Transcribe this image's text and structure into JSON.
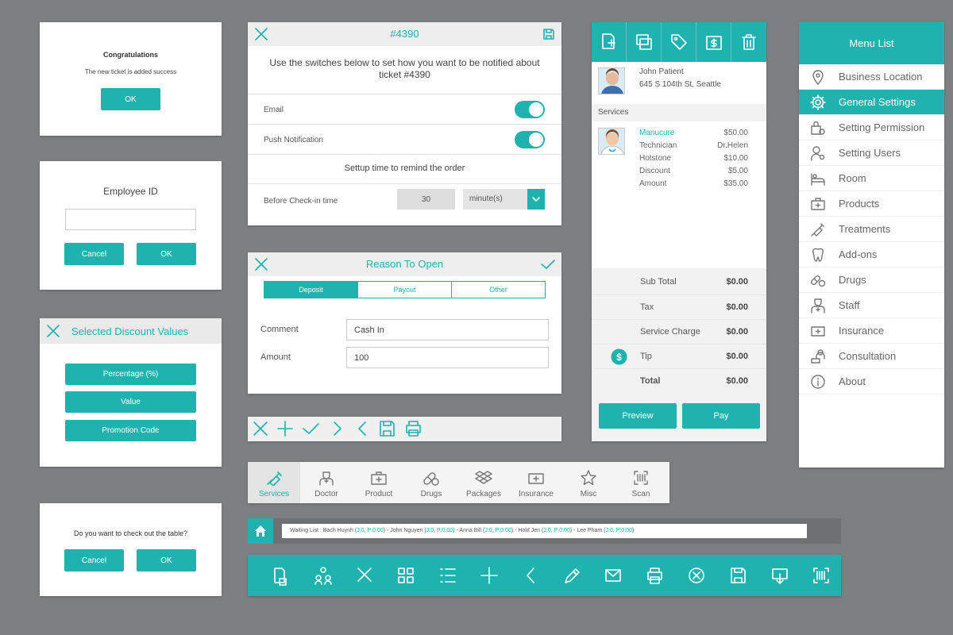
{
  "congrats": {
    "title": "Congratulations",
    "message": "The new ticket is added success",
    "ok": "OK"
  },
  "employee": {
    "title": "Employee ID",
    "value": "",
    "cancel": "Cancel",
    "ok": "OK"
  },
  "discount": {
    "title": "Selected Discount Values",
    "options": [
      "Percentage (%)",
      "Value",
      "Promotion Code"
    ]
  },
  "checkout": {
    "question": "Do you want to check out the table?",
    "cancel": "Cancel",
    "ok": "OK"
  },
  "notify": {
    "ticket": "#4390",
    "description": "Use the switches below to set how you want to be notified about ticket #4390",
    "email_label": "Email",
    "push_label": "Push Notification",
    "email_on": true,
    "push_on": true,
    "setup_title": "Settup time to remind the order",
    "before_label": "Before Check-in time",
    "before_value": "30",
    "unit": "minute(s)"
  },
  "reason": {
    "title": "Reason To Open",
    "tabs": [
      "Deposit",
      "Payout",
      "Other"
    ],
    "active_tab": "Deposit",
    "comment_label": "Comment",
    "comment_value": "Cash In",
    "amount_label": "Amount",
    "amount_value": "100"
  },
  "category_tabs": [
    "Services",
    "Doctor",
    "Product",
    "Drugs",
    "Packages",
    "Insurance",
    "Misc",
    "Scan"
  ],
  "waiting": {
    "prefix": "Waiting List : ",
    "entries": [
      {
        "name": "Bach Huynh",
        "status": "J:0, P:0:00"
      },
      {
        "name": "John Nguyen",
        "status": "J:0, P:0:00"
      },
      {
        "name": "Anna Bill",
        "status": "J:0, P:0:00"
      },
      {
        "name": "Hold Jen",
        "status": "J:0, P:0:00"
      },
      {
        "name": "Lee Pham",
        "status": "J:0, P:0:00"
      }
    ]
  },
  "ticket": {
    "patient_name": "John Patient",
    "patient_address": "645 S 104th St, Seattle",
    "services_header": "Services",
    "service_name": "Manucure",
    "service_price": "$50.00",
    "details": [
      {
        "label": "Technician",
        "value": "Dr.Helen"
      },
      {
        "label": "Hotstone",
        "value": "$10.00"
      },
      {
        "label": "Discount",
        "value": "$5.00"
      },
      {
        "label": "Amount",
        "value": "$35.00"
      }
    ],
    "summary": [
      {
        "label": "Sub Total",
        "value": "$0.00"
      },
      {
        "label": "Tax",
        "value": "$0.00"
      },
      {
        "label": "Service Charge",
        "value": "$0.00"
      },
      {
        "label": "Tip",
        "value": "$0.00"
      },
      {
        "label": "Total",
        "value": "$0.00"
      }
    ],
    "preview": "Preview",
    "pay": "Pay"
  },
  "menu": {
    "title": "Menu List",
    "items": [
      {
        "label": "Business Location",
        "icon": "location-pin-icon"
      },
      {
        "label": "General Settings",
        "icon": "gear-icon"
      },
      {
        "label": "Setting Permission",
        "icon": "lock-bag-icon"
      },
      {
        "label": "Setting Users",
        "icon": "user-settings-icon"
      },
      {
        "label": "Room",
        "icon": "bed-icon"
      },
      {
        "label": "Products",
        "icon": "medkit-icon"
      },
      {
        "label": "Treatments",
        "icon": "syringe-icon"
      },
      {
        "label": "Add-ons",
        "icon": "tooth-icon"
      },
      {
        "label": "Drugs",
        "icon": "pills-icon"
      },
      {
        "label": "Staff",
        "icon": "staff-icon"
      },
      {
        "label": "Insurance",
        "icon": "insurance-card-icon"
      },
      {
        "label": "Consultation",
        "icon": "consultation-icon"
      },
      {
        "label": "About",
        "icon": "info-icon"
      }
    ],
    "active": "General Settings"
  },
  "colors": {
    "accent": "#1fb2ae",
    "background": "#7d7f82"
  }
}
